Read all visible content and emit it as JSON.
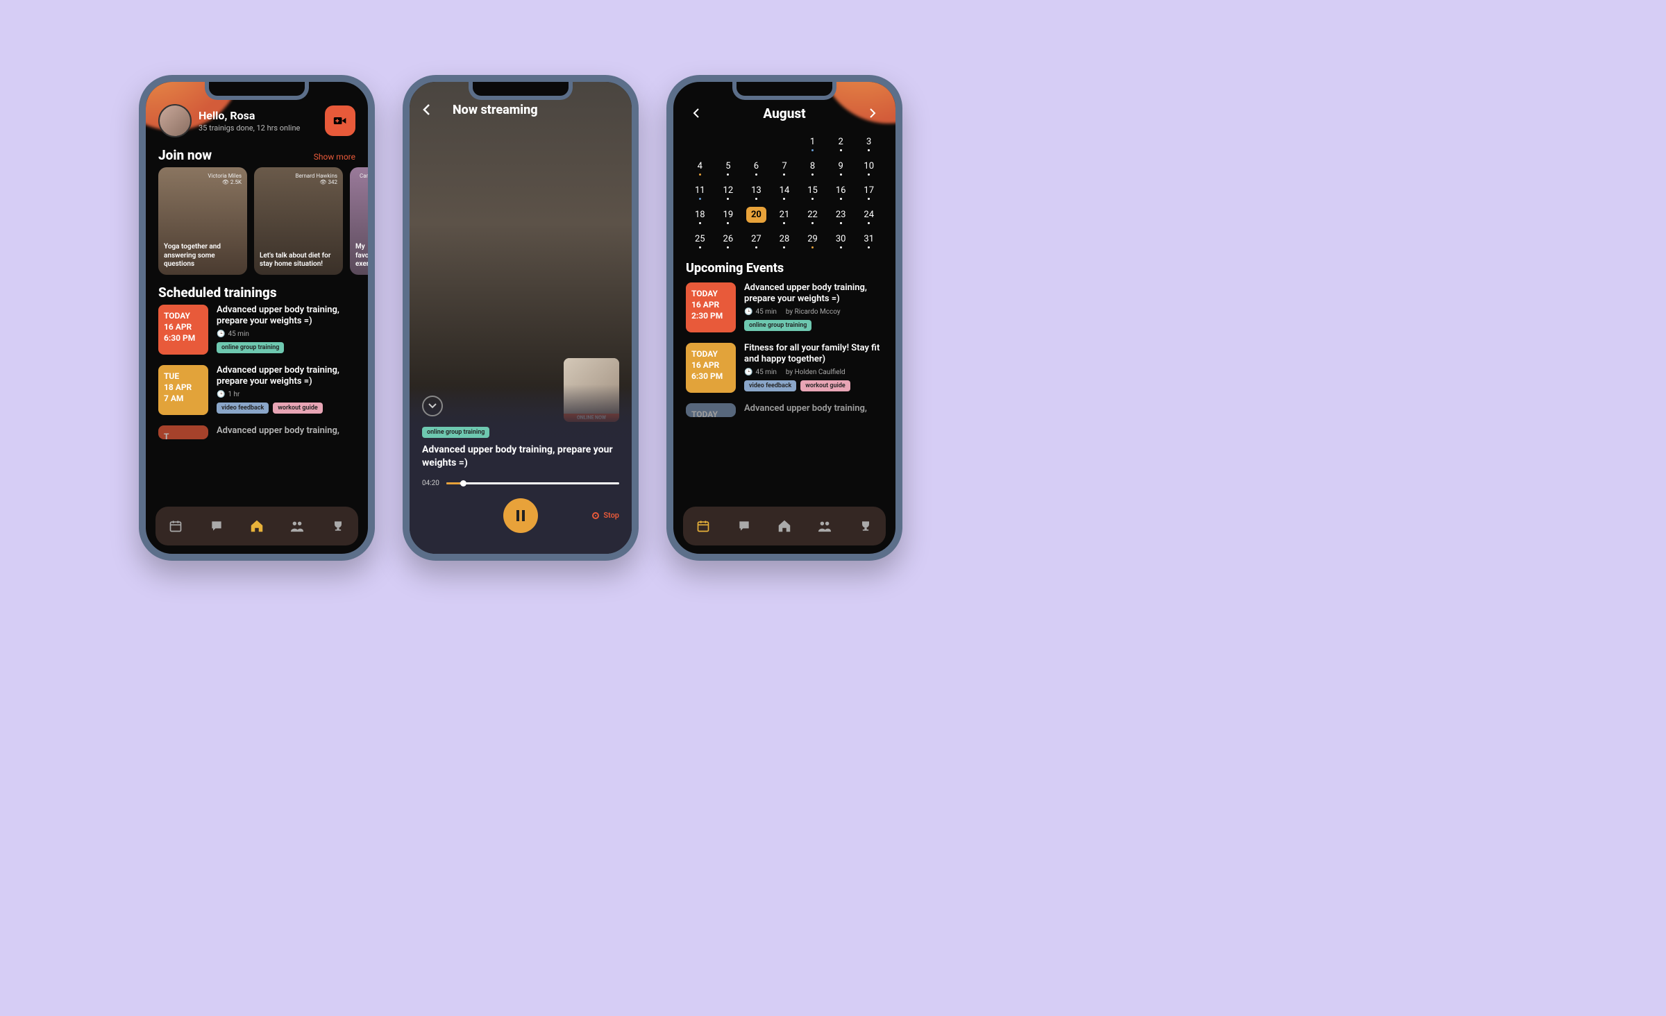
{
  "phone1": {
    "greeting": "Hello, Rosa",
    "substat": "35 trainigs done, 12 hrs online",
    "join_title": "Join now",
    "show_more": "Show more",
    "cards": [
      {
        "author": "Victoria Miles",
        "views": "2.5K",
        "title": "Yoga together and answering some questions"
      },
      {
        "author": "Bernard Hawkins",
        "views": "342",
        "title": "Let's talk about diet for stay home situation!"
      },
      {
        "author": "Camero",
        "views": "",
        "title": "My favo exercise"
      }
    ],
    "sched_title": "Scheduled trainings",
    "sched": [
      {
        "day": "TODAY",
        "date": "16 APR",
        "time": "6:30 PM",
        "color": "db-orange",
        "title": "Advanced upper body training, prepare your weights =)",
        "dur": "45 min",
        "tags": [
          {
            "t": "online group training",
            "c": "mint"
          }
        ]
      },
      {
        "day": "TUE",
        "date": "18 APR",
        "time": "7 AM",
        "color": "db-yellow",
        "title": "Advanced upper body training, prepare your weights =)",
        "dur": "1 hr",
        "tags": [
          {
            "t": "video feedback",
            "c": "blue"
          },
          {
            "t": "workout guide",
            "c": "pink"
          }
        ]
      },
      {
        "day": "T",
        "date": "",
        "time": "",
        "color": "db-orange",
        "title": "Advanced upper body training,",
        "dur": "",
        "tags": []
      }
    ]
  },
  "phone2": {
    "header": "Now streaming",
    "tag": "online group training",
    "pip_label": "ONLINE NOW",
    "title": "Advanced upper body training, prepare your weights =)",
    "time": "04:20",
    "stop": "Stop"
  },
  "phone3": {
    "month": "August",
    "weeks": [
      [
        null,
        null,
        null,
        null,
        {
          "d": 1,
          "dot": "b"
        },
        {
          "d": 2,
          "dot": "w"
        },
        {
          "d": 3,
          "dot": "w"
        }
      ],
      [
        {
          "d": 4,
          "dot": "o"
        },
        {
          "d": 5,
          "dot": "w"
        },
        {
          "d": 6,
          "dot": "w"
        },
        {
          "d": 7,
          "dot": "w"
        },
        {
          "d": 8,
          "dot": "w"
        },
        {
          "d": 9,
          "dot": "w"
        },
        {
          "d": 10,
          "dot": "w"
        }
      ],
      [
        {
          "d": 11,
          "dot": "b"
        },
        {
          "d": 12,
          "dot": "w"
        },
        {
          "d": 13,
          "dot": "w"
        },
        {
          "d": 14,
          "dot": "w"
        },
        {
          "d": 15,
          "dot": "w"
        },
        {
          "d": 16,
          "dot": "w"
        },
        {
          "d": 17,
          "dot": "w"
        }
      ],
      [
        {
          "d": 18,
          "dot": "w"
        },
        {
          "d": 19,
          "dot": "w"
        },
        {
          "d": 20,
          "dot": "",
          "sel": true
        },
        {
          "d": 21,
          "dot": "w"
        },
        {
          "d": 22,
          "dot": "w"
        },
        {
          "d": 23,
          "dot": "w"
        },
        {
          "d": 24,
          "dot": "w"
        }
      ],
      [
        {
          "d": 25,
          "dot": "w"
        },
        {
          "d": 26,
          "dot": "w"
        },
        {
          "d": 27,
          "dot": "w"
        },
        {
          "d": 28,
          "dot": "w"
        },
        {
          "d": 29,
          "dot": "o"
        },
        {
          "d": 30,
          "dot": "w"
        },
        {
          "d": 31,
          "dot": "w"
        }
      ]
    ],
    "upcoming_title": "Upcoming Events",
    "events": [
      {
        "day": "TODAY",
        "date": "16 APR",
        "time": "2:30 PM",
        "color": "db-orange",
        "title": "Advanced upper body training, prepare your weights =)",
        "dur": "45 min",
        "by": "by Ricardo Mccoy",
        "tags": [
          {
            "t": "online group training",
            "c": "mint"
          }
        ]
      },
      {
        "day": "TODAY",
        "date": "16 APR",
        "time": "6:30 PM",
        "color": "db-yellow",
        "title": "Fitness for all your family! Stay fit and happy together)",
        "dur": "45 min",
        "by": "by Holden Caulfield",
        "tags": [
          {
            "t": "video feedback",
            "c": "blue"
          },
          {
            "t": "workout guide",
            "c": "pink"
          }
        ]
      },
      {
        "day": "TODAY",
        "date": "",
        "time": "",
        "color": "db-blue",
        "title": "Advanced upper body training,",
        "dur": "",
        "by": "",
        "tags": []
      }
    ]
  }
}
